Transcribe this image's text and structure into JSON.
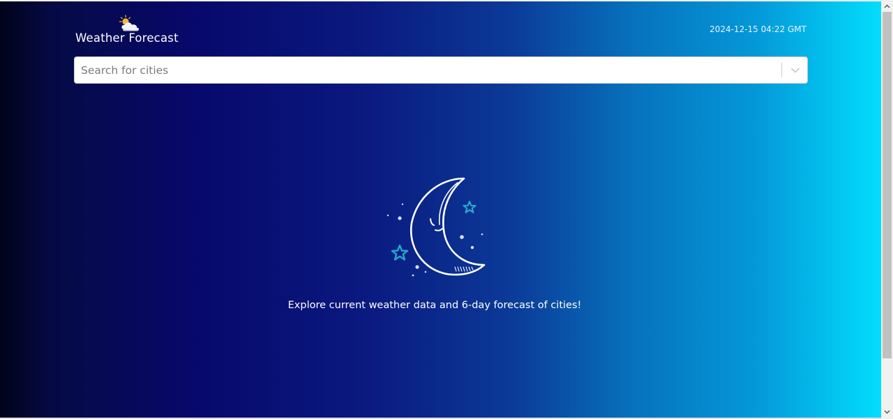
{
  "header": {
    "logo_text": "Weather Forecast",
    "logo_icon": "partly-cloudy-icon",
    "datetime": "2024-12-15 04:22 GMT"
  },
  "search": {
    "placeholder": "Search for cities",
    "value": "",
    "dropdown_icon": "chevron-down-icon"
  },
  "main": {
    "illustration": "moon-stars-icon",
    "message": "Explore current weather data and 6-day forecast of cities!"
  },
  "colors": {
    "gradient_start": "#02031a",
    "gradient_mid": "#07086b",
    "gradient_end": "#02ddfd",
    "star_color": "#2aa7c9",
    "text": "#ffffff"
  }
}
